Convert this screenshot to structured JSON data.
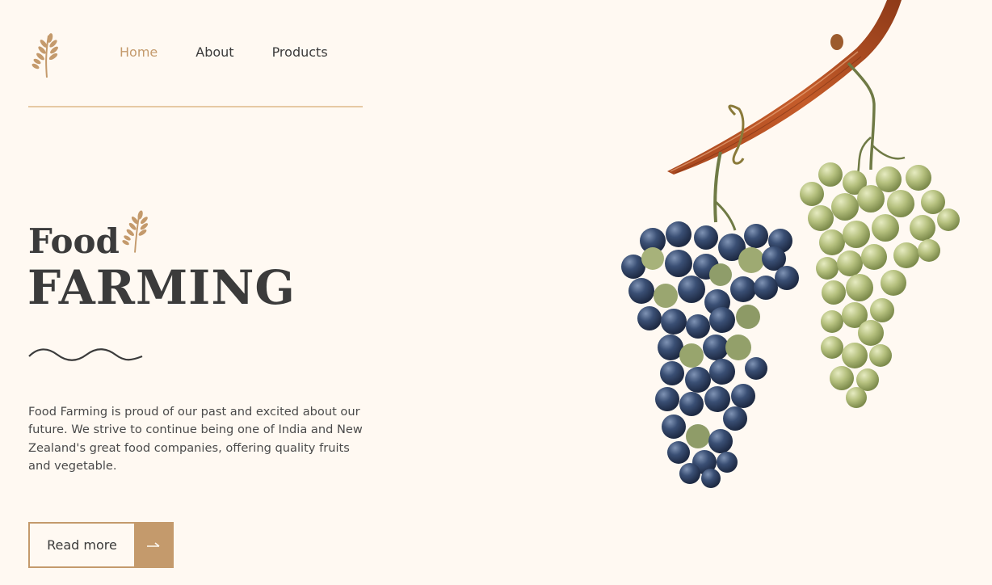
{
  "nav": {
    "items": [
      {
        "label": "Home",
        "active": true
      },
      {
        "label": "About",
        "active": false
      },
      {
        "label": "Products",
        "active": false
      }
    ]
  },
  "hero": {
    "title_line1": "Food",
    "title_line2": "FARMING",
    "description": "Food Farming is proud of our past and excited about our future. We strive to continue being one of India and New Zealand's great food companies, offering quality fruits and vegetable.",
    "button_label": "Read more"
  },
  "colors": {
    "background": "#fff9f2",
    "accent": "#c49a6c",
    "text": "#3b3b3b",
    "rule": "#e7c9a3"
  },
  "icons": {
    "logo": "wheat-icon",
    "title_decoration": "wheat-icon",
    "button": "arrow-right-icon"
  }
}
